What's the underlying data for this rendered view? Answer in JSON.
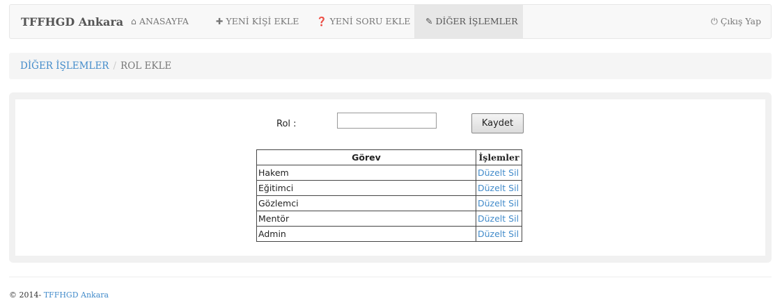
{
  "navbar": {
    "brand": "TFFHGD Ankara",
    "items": [
      {
        "label": "ANASAYFA",
        "icon": "home-icon",
        "glyph": "⌂"
      },
      {
        "label": "YENİ KİŞİ EKLE",
        "icon": "plus-icon",
        "glyph": "✚"
      },
      {
        "label": "YENİ SORU EKLE",
        "icon": "question-icon",
        "glyph": "❓"
      },
      {
        "label": "DİĞER İŞLEMLER",
        "icon": "edit-icon",
        "glyph": "✎"
      }
    ],
    "logout": {
      "label": "Çıkış Yap",
      "icon": "power-icon",
      "glyph": "⏻"
    }
  },
  "breadcrumb": {
    "parent": "DİĞER İŞLEMLER",
    "separator": "/",
    "current": "ROL EKLE"
  },
  "form": {
    "label": "Rol :",
    "input_value": "",
    "save_label": "Kaydet"
  },
  "table": {
    "headers": [
      "Görev",
      "İşlemler"
    ],
    "rows": [
      {
        "name": "Hakem",
        "edit": "Düzelt",
        "delete": "Sil"
      },
      {
        "name": "Eğitimci",
        "edit": "Düzelt",
        "delete": "Sil"
      },
      {
        "name": "Gözlemci",
        "edit": "Düzelt",
        "delete": "Sil"
      },
      {
        "name": "Mentör",
        "edit": "Düzelt",
        "delete": "Sil"
      },
      {
        "name": "Admin",
        "edit": "Düzelt",
        "delete": "Sil"
      }
    ]
  },
  "footer": {
    "copyright": "© 2014-",
    "link": "TFFHGD Ankara"
  },
  "colors": {
    "link": "#428bca",
    "navbar_bg": "#f8f8f8",
    "active_bg": "#e7e7e7",
    "panel_bg": "#f1f1f1"
  }
}
